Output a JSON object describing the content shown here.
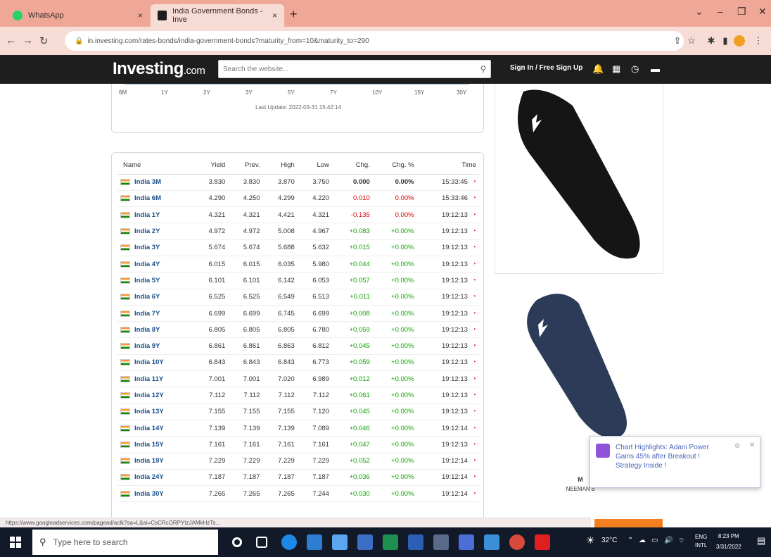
{
  "browser": {
    "tabs": [
      {
        "label": "WhatsApp",
        "close": "×"
      },
      {
        "label": "India Government Bonds - Inve",
        "close": "×"
      }
    ],
    "new_tab": "+",
    "url": "in.investing.com/rates-bonds/india-government-bonds?maturity_from=10&maturity_to=290",
    "status_url": "https://www.googleadservices.com/pagead/aclk?sa=L&ai=CsCRcORPYtzJAMkHzTs..."
  },
  "site": {
    "logo": "Investing",
    "logo_suffix": ".com",
    "search_placeholder": "Search the website...",
    "signin": "Sign In / Free Sign Up"
  },
  "chart": {
    "x_ticks": [
      "6M",
      "1Y",
      "2Y",
      "3Y",
      "5Y",
      "7Y",
      "10Y",
      "15Y",
      "30Y"
    ],
    "last_update": "Last Update: 2022-03-31 15:42:14"
  },
  "table": {
    "headers": [
      "Name",
      "Yield",
      "Prev.",
      "High",
      "Low",
      "Chg.",
      "Chg. %",
      "Time"
    ],
    "rows": [
      {
        "name": "India 3M",
        "yield": "3.830",
        "prev": "3.830",
        "high": "3.870",
        "low": "3.750",
        "chg": "0.000",
        "chgp": "0.00%",
        "time": "15:33:45",
        "dir": "neu"
      },
      {
        "name": "India 6M",
        "yield": "4.290",
        "prev": "4.250",
        "high": "4.299",
        "low": "4.220",
        "chg": "0.010",
        "chgp": "0.00%",
        "time": "15:33:46",
        "dir": "neg"
      },
      {
        "name": "India 1Y",
        "yield": "4.321",
        "prev": "4.321",
        "high": "4.421",
        "low": "4.321",
        "chg": "-0.135",
        "chgp": "0.00%",
        "time": "19:12:13",
        "dir": "neg"
      },
      {
        "name": "India 2Y",
        "yield": "4.972",
        "prev": "4.972",
        "high": "5.008",
        "low": "4.967",
        "chg": "+0.083",
        "chgp": "+0.00%",
        "time": "19:12:13",
        "dir": "pos"
      },
      {
        "name": "India 3Y",
        "yield": "5.674",
        "prev": "5.674",
        "high": "5.688",
        "low": "5.632",
        "chg": "+0.015",
        "chgp": "+0.00%",
        "time": "19:12:13",
        "dir": "pos"
      },
      {
        "name": "India 4Y",
        "yield": "6.015",
        "prev": "6.015",
        "high": "6.035",
        "low": "5.980",
        "chg": "+0.044",
        "chgp": "+0.00%",
        "time": "19:12:13",
        "dir": "pos"
      },
      {
        "name": "India 5Y",
        "yield": "6.101",
        "prev": "6.101",
        "high": "6.142",
        "low": "6.053",
        "chg": "+0.057",
        "chgp": "+0.00%",
        "time": "19:12:13",
        "dir": "pos"
      },
      {
        "name": "India 6Y",
        "yield": "6.525",
        "prev": "6.525",
        "high": "6.549",
        "low": "6.513",
        "chg": "+0.011",
        "chgp": "+0.00%",
        "time": "19:12:13",
        "dir": "pos"
      },
      {
        "name": "India 7Y",
        "yield": "6.699",
        "prev": "6.699",
        "high": "6.745",
        "low": "6.699",
        "chg": "+0.008",
        "chgp": "+0.00%",
        "time": "19:12:13",
        "dir": "pos"
      },
      {
        "name": "India 8Y",
        "yield": "6.805",
        "prev": "6.805",
        "high": "6.805",
        "low": "6.780",
        "chg": "+0.059",
        "chgp": "+0.00%",
        "time": "19:12:13",
        "dir": "pos"
      },
      {
        "name": "India 9Y",
        "yield": "6.861",
        "prev": "6.861",
        "high": "6.863",
        "low": "6.812",
        "chg": "+0.045",
        "chgp": "+0.00%",
        "time": "19:12:13",
        "dir": "pos"
      },
      {
        "name": "India 10Y",
        "yield": "6.843",
        "prev": "6.843",
        "high": "6.843",
        "low": "6.773",
        "chg": "+0.059",
        "chgp": "+0.00%",
        "time": "19:12:13",
        "dir": "pos"
      },
      {
        "name": "India 11Y",
        "yield": "7.001",
        "prev": "7.001",
        "high": "7.020",
        "low": "6.989",
        "chg": "+0.012",
        "chgp": "+0.00%",
        "time": "19:12:13",
        "dir": "pos"
      },
      {
        "name": "India 12Y",
        "yield": "7.112",
        "prev": "7.112",
        "high": "7.112",
        "low": "7.112",
        "chg": "+0.061",
        "chgp": "+0.00%",
        "time": "19:12:13",
        "dir": "pos"
      },
      {
        "name": "India 13Y",
        "yield": "7.155",
        "prev": "7.155",
        "high": "7.155",
        "low": "7.120",
        "chg": "+0.045",
        "chgp": "+0.00%",
        "time": "19:12:13",
        "dir": "pos"
      },
      {
        "name": "India 14Y",
        "yield": "7.139",
        "prev": "7.139",
        "high": "7.139",
        "low": "7.089",
        "chg": "+0.046",
        "chgp": "+0.00%",
        "time": "19:12:14",
        "dir": "pos"
      },
      {
        "name": "India 15Y",
        "yield": "7.161",
        "prev": "7.161",
        "high": "7.161",
        "low": "7.161",
        "chg": "+0.047",
        "chgp": "+0.00%",
        "time": "19:12:13",
        "dir": "pos"
      },
      {
        "name": "India 19Y",
        "yield": "7.229",
        "prev": "7.229",
        "high": "7.229",
        "low": "7.229",
        "chg": "+0.052",
        "chgp": "+0.00%",
        "time": "19:12:14",
        "dir": "pos"
      },
      {
        "name": "India 24Y",
        "yield": "7.187",
        "prev": "7.187",
        "high": "7.187",
        "low": "7.187",
        "chg": "+0.036",
        "chgp": "+0.00%",
        "time": "19:12:14",
        "dir": "pos"
      },
      {
        "name": "India 30Y",
        "yield": "7.265",
        "prev": "7.265",
        "high": "7.265",
        "low": "7.244",
        "chg": "+0.030",
        "chgp": "+0.00%",
        "time": "19:12:14",
        "dir": "pos"
      }
    ]
  },
  "ad": {
    "brand": "NEEMAN'S"
  },
  "popup": {
    "text": "Chart Highlights: Adani Power Gains 45% after Breakout ! Strategy Inside !"
  },
  "taskbar": {
    "search_placeholder": "Type here to search",
    "weather": "32°C",
    "lang1": "ENG",
    "lang2": "INTL",
    "time": "8:23 PM",
    "date": "3/31/2022"
  },
  "colors": {
    "tabbar": "#efa898",
    "site_header": "#1e1e1e",
    "positive": "#0ea600",
    "negative": "#e00000",
    "link": "#1a4e8a"
  }
}
